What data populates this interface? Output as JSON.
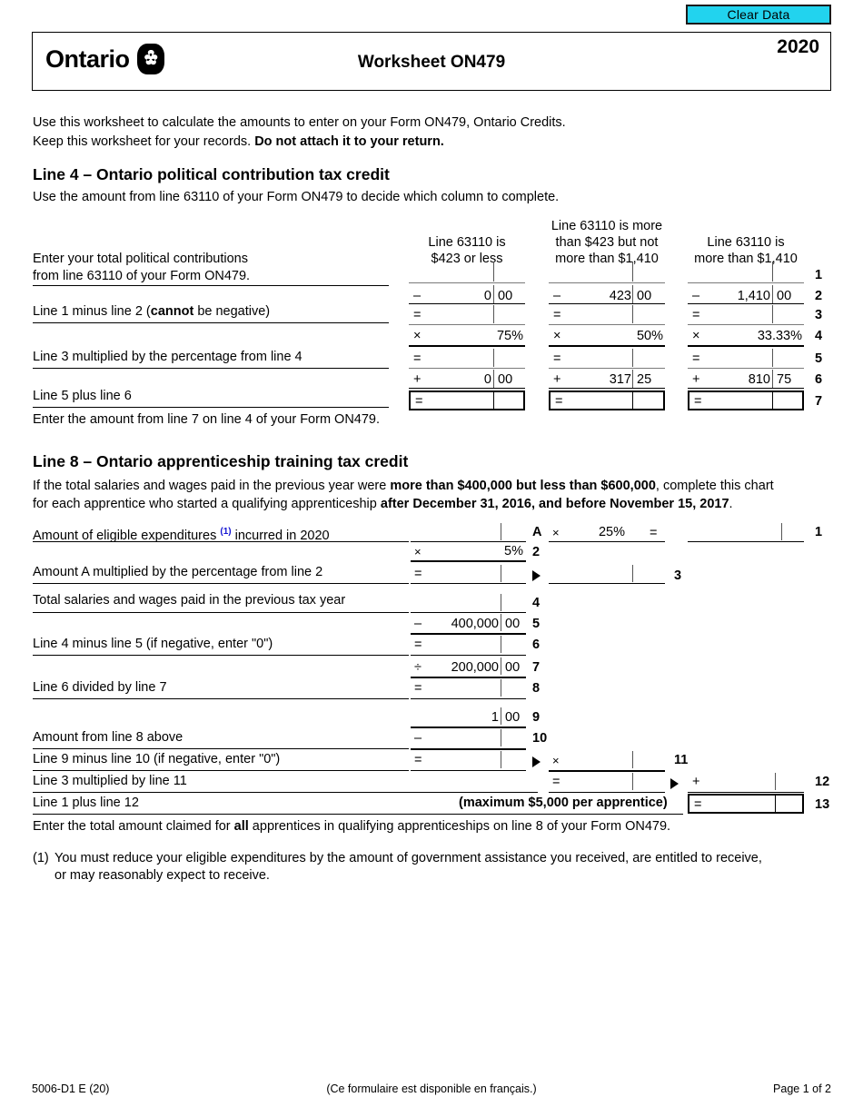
{
  "toolbar": {
    "clear_data_label": "Clear Data"
  },
  "header": {
    "province": "Ontario",
    "logo_icon": "ontario-trillium-logo",
    "title": "Worksheet ON479",
    "year": "2020"
  },
  "intro": {
    "line1": "Use this worksheet to calculate the amounts to enter on your Form ON479, Ontario Credits.",
    "line2_plain": "Keep this worksheet for your records. ",
    "line2_bold": "Do not attach it to your return."
  },
  "section_political": {
    "heading": "Line 4 – Ontario political contribution tax credit",
    "instruction": "Use the amount from line 63110 of your Form ON479 to decide which column to complete.",
    "column_headers": [
      "Line 63110 is\n$423 or less",
      "Line 63110 is more\nthan $423 but not\nmore than $1,410",
      "Line 63110 is\nmore than $1,410"
    ],
    "labels": {
      "row1": "Enter your total political contributions\nfrom line 63110 of your Form ON479.",
      "row3": "Line 1 minus line 2 (",
      "row3_bold": "cannot",
      "row3_tail": " be negative)",
      "row5": "Line 3 multiplied by the percentage from line 4",
      "row7": "Line 5 plus line 6"
    },
    "rows": [
      {
        "no": "1",
        "op": "",
        "values": [
          "",
          "",
          ""
        ],
        "cents": [
          "",
          "",
          ""
        ]
      },
      {
        "no": "2",
        "op": "–",
        "values": [
          "0",
          "423",
          "1,410"
        ],
        "cents": [
          "00",
          "00",
          "00"
        ]
      },
      {
        "no": "3",
        "op": "=",
        "values": [
          "",
          "",
          ""
        ],
        "cents": [
          "",
          "",
          ""
        ]
      },
      {
        "no": "4",
        "op": "×",
        "values": [
          "75%",
          "50%",
          "33.33%"
        ],
        "cents": [
          "",
          "",
          ""
        ]
      },
      {
        "no": "5",
        "op": "=",
        "values": [
          "",
          "",
          ""
        ],
        "cents": [
          "",
          "",
          ""
        ]
      },
      {
        "no": "6",
        "op": "+",
        "values": [
          "0",
          "317",
          "810"
        ],
        "cents": [
          "00",
          "25",
          "75"
        ]
      },
      {
        "no": "7",
        "op": "=",
        "values": [
          "",
          "",
          ""
        ],
        "cents": [
          "",
          "",
          ""
        ]
      }
    ],
    "footer_note": "Enter the amount from line 7 on line 4 of your Form ON479."
  },
  "section_apprenticeship": {
    "heading": "Line 8 – Ontario apprenticeship training tax credit",
    "intro_a": "If the total salaries and wages paid in the previous year were ",
    "intro_a_bold": "more than $400,000 but less than $600,000",
    "intro_a_tail": ", complete this chart",
    "intro_b": "for each apprentice who started a qualifying apprenticeship ",
    "intro_b_bold": "after December 31, 2016, and before November 15, 2017",
    "intro_b_tail": ".",
    "labels": {
      "row_a": "Amount of eligible expenditures ",
      "row_a_sup": "(1)",
      "row_a_tail": " incurred in 2020",
      "row3": "Amount A multiplied by the percentage from line 2",
      "row4": "Total salaries and wages paid in the previous tax year",
      "row6": "Line 4 minus line 5 (if negative, enter \"0\")",
      "row8": "Line 6 divided by line 7",
      "row10": "Amount from line 8 above",
      "row11": "Line 9 minus line 10 (if negative, enter \"0\")",
      "row12": "Line 3 multiplied by line 11",
      "row13": "Line 1 plus line 12"
    },
    "amount_a_tag": "A",
    "percent_25": "25%",
    "percent_5": "5%",
    "equals_sign": "=",
    "mult_sign": "×",
    "minus_sign": "–",
    "plus_sign": "+",
    "divide_sign": "÷",
    "value_400000": "400,000",
    "value_400000_cents": "00",
    "value_200000": "200,000",
    "value_200000_cents": "00",
    "value_1": "1",
    "value_1_cents": "00",
    "maximum_note": "(maximum $5,000 per apprentice)",
    "line_numbers": [
      "1",
      "2",
      "3",
      "4",
      "5",
      "6",
      "7",
      "8",
      "9",
      "10",
      "11",
      "12",
      "13"
    ],
    "footer_note_plain_a": "Enter the total amount claimed for ",
    "footer_note_bold": "all",
    "footer_note_plain_b": " apprentices in qualifying apprenticeships on line 8 of your Form ON479.",
    "footnote_marker": "(1)",
    "footnote_line1": "You must reduce your eligible expenditures by the amount of government assistance you received, are entitled to receive,",
    "footnote_line2": "or may reasonably expect to receive."
  },
  "footer": {
    "form_code": "5006-D1 E (20)",
    "french_note": "(Ce formulaire est disponible en français.)",
    "page_label": "Page 1 of 2"
  },
  "colors": {
    "clear_button_bg": "#22d3ee",
    "footnote_marker": "#1414d2",
    "rule_light": "#7a7a7a",
    "rule_dark": "#000000"
  }
}
